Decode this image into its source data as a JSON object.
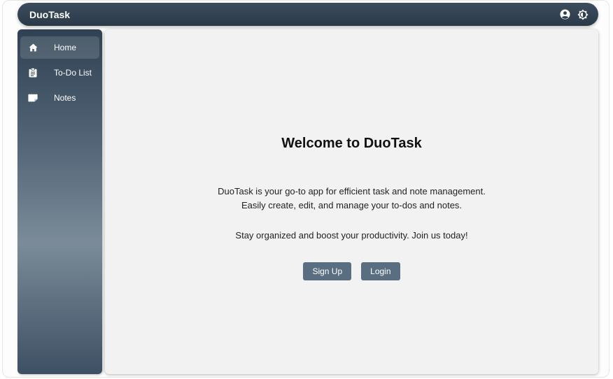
{
  "app": {
    "title": "DuoTask"
  },
  "header": {
    "icons": [
      "account-icon",
      "theme-toggle-icon"
    ]
  },
  "sidebar": {
    "items": [
      {
        "label": "Home",
        "icon": "home-icon",
        "active": true
      },
      {
        "label": "To-Do List",
        "icon": "clipboard-icon",
        "active": false
      },
      {
        "label": "Notes",
        "icon": "note-icon",
        "active": false
      }
    ]
  },
  "main": {
    "heading": "Welcome to DuoTask",
    "description_line1": "DuoTask is your go-to app for efficient task and note management.",
    "description_line2": "Easily create, edit, and manage your to-dos and notes.",
    "tagline": "Stay organized and boost your productivity. Join us today!",
    "signup_label": "Sign Up",
    "login_label": "Login"
  },
  "colors": {
    "header_bg": "#2f3f4f",
    "button_bg": "#5a6e82",
    "content_bg": "#f2f2f2"
  }
}
